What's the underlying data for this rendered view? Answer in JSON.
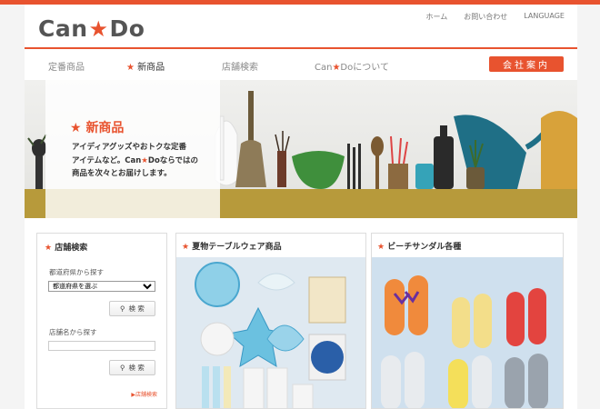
{
  "brand": {
    "name_left": "Can",
    "name_right": "Do",
    "accent": "#e8532f"
  },
  "utility_nav": [
    "ホーム",
    "お問い合わせ",
    "LANGUAGE"
  ],
  "main_nav": {
    "items": [
      "定番商品",
      "新商品",
      "店舗検索"
    ],
    "about_left": "Can",
    "about_right": "Doについて",
    "company": "会社案内"
  },
  "hero": {
    "title": "新商品",
    "line1": "アイディアグッズやおトクな定番",
    "line2_a": "アイテムなど。Can",
    "line2_b": "Doならではの",
    "line3": "商品を次々とお届けします。"
  },
  "store_search": {
    "title": "店舗検索",
    "by_pref_label": "都道府県から探す",
    "pref_selected": "都道府県を選ぶ",
    "search_button": "検 索",
    "by_name_label": "店舗名から探す",
    "search_button_2": "検 索",
    "more_link": "店舗検索"
  },
  "cards": [
    {
      "title": "夏物テーブルウェア商品"
    },
    {
      "title": "ビーチサンダル各種"
    }
  ]
}
